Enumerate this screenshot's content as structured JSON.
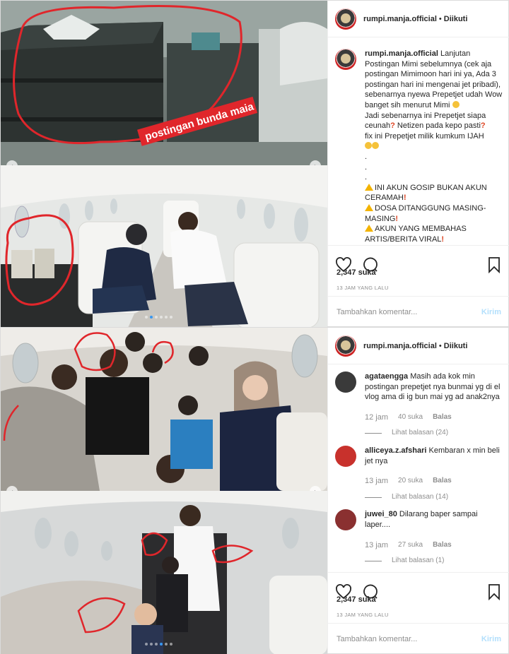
{
  "post1": {
    "username": "rumpi.manja.official",
    "separator": "•",
    "follow_label": "Diikuti",
    "photo_top_tag": "postingan bunda maia",
    "caption": {
      "username": "rumpi.manja.official",
      "text": " Lanjutan Postingan Mimi sebelumnya (cek aja postingan Mimimoon hari ini ya, Ada 3 postingan hari ini mengenai jet pribadi), sebenarnya nyewa Prepetjet udah Wow banget sih menurut Mimi ",
      "text2": "\nJadi sebenarnya ini Prepetjet siapa ceunah",
      "text3": " Netizen pada kepo pasti",
      "text4": "\nfix ini Prepetjet milik kumkum IJAH\n",
      "dots": "\n.\n.\n.\n",
      "warn1": "INI AKUN GOSIP BUKAN AKUN CERAMAH",
      "warn2": "DOSA DITANGGUNG MASING-MASING",
      "warn3": "AKUN YANG MEMBAHAS ARTIS/BERITA VIRAL"
    },
    "likes": "2,347 suka",
    "time": "13 JAM YANG LALU",
    "comment_placeholder": "Tambahkan komentar...",
    "send_label": "Kirim"
  },
  "post2": {
    "username": "rumpi.manja.official",
    "separator": "•",
    "follow_label": "Diikuti",
    "comments": [
      {
        "user": "agataengga",
        "text": " Masih ada kok min postingan prepetjet nya bunmai yg di el vlog ama di ig bun mai yg ad anak2nya",
        "time": "12 jam",
        "likes": "40 suka",
        "reply": "Balas",
        "more": "Lihat balasan (24)",
        "avatar_color": "#3a3a3a"
      },
      {
        "user": "alliceya.z.afshari",
        "text": " Kembaran x min beli jet nya",
        "time": "13 jam",
        "likes": "20 suka",
        "reply": "Balas",
        "more": "Lihat balasan (14)",
        "avatar_color": "#c8312c"
      },
      {
        "user": "juwei_80",
        "text": " Dilarang baper sampai laper....",
        "time": "13 jam",
        "likes": "27 suka",
        "reply": "Balas",
        "more": "Lihat balasan (1)",
        "avatar_color": "#8a3030"
      }
    ],
    "likes": "2,347 suka",
    "time": "13 JAM YANG LALU",
    "comment_placeholder": "Tambahkan komentar...",
    "send_label": "Kirim"
  },
  "icons": [
    "heart-icon",
    "comment-icon",
    "bookmark-icon",
    "chevron-left-icon",
    "chevron-right-icon"
  ],
  "colors": {
    "annotation_red": "#e0262b",
    "link_blue": "#3897f0",
    "send_disabled": "#b2dffc",
    "meta_gray": "#8e8e8e"
  }
}
